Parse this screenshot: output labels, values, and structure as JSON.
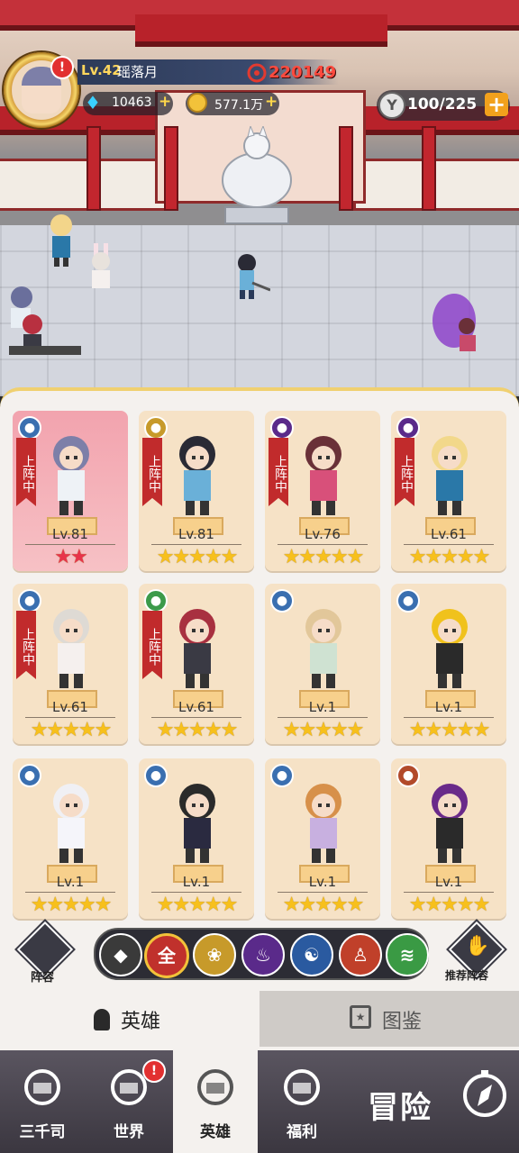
{
  "player": {
    "level": "Lv.42",
    "name": "瑶落月",
    "power": "220149",
    "diamonds": "10463",
    "gold": "577.1万",
    "energy": "100/225",
    "notice": "!"
  },
  "heroes": [
    {
      "level": "Lv.81",
      "stars": "★★",
      "star_color": "red",
      "deployed": true,
      "deploy_label": "上阵中",
      "element": "water",
      "element_color": "#3a6fb0",
      "bg": "pink"
    },
    {
      "level": "Lv.81",
      "stars": "★★★★★",
      "star_color": "gold",
      "deployed": true,
      "deploy_label": "上阵中",
      "element": "lotus",
      "element_color": "#c79a2a",
      "bg": "tan"
    },
    {
      "level": "Lv.76",
      "stars": "★★★★★",
      "star_color": "gold",
      "deployed": true,
      "deploy_label": "上阵中",
      "element": "fire",
      "element_color": "#5a2a8a",
      "bg": "tan"
    },
    {
      "level": "Lv.61",
      "stars": "★★★★★",
      "star_color": "gold",
      "deployed": true,
      "deploy_label": "上阵中",
      "element": "fire",
      "element_color": "#5a2a8a",
      "bg": "tan"
    },
    {
      "level": "Lv.61",
      "stars": "★★★★★",
      "star_color": "gold",
      "deployed": true,
      "deploy_label": "上阵中",
      "element": "water",
      "element_color": "#3a6fb0",
      "bg": "tan"
    },
    {
      "level": "Lv.61",
      "stars": "★★★★★",
      "star_color": "gold",
      "deployed": true,
      "deploy_label": "上阵中",
      "element": "dna",
      "element_color": "#3c9a4a",
      "bg": "tan"
    },
    {
      "level": "Lv.1",
      "stars": "★★★★★",
      "star_color": "gold",
      "deployed": false,
      "deploy_label": "",
      "element": "water",
      "element_color": "#3a6fb0",
      "bg": "tan"
    },
    {
      "level": "Lv.1",
      "stars": "★★★★★",
      "star_color": "gold",
      "deployed": false,
      "deploy_label": "",
      "element": "water",
      "element_color": "#3a6fb0",
      "bg": "tan"
    },
    {
      "level": "Lv.1",
      "stars": "★★★★★",
      "star_color": "gold",
      "deployed": false,
      "deploy_label": "",
      "element": "water",
      "element_color": "#3a6fb0",
      "bg": "tan"
    },
    {
      "level": "Lv.1",
      "stars": "★★★★★",
      "star_color": "gold",
      "deployed": false,
      "deploy_label": "",
      "element": "water",
      "element_color": "#3a6fb0",
      "bg": "tan"
    },
    {
      "level": "Lv.1",
      "stars": "★★★★★",
      "star_color": "gold",
      "deployed": false,
      "deploy_label": "",
      "element": "water",
      "element_color": "#3a6fb0",
      "bg": "tan"
    },
    {
      "level": "Lv.1",
      "stars": "★★★★★",
      "star_color": "gold",
      "deployed": false,
      "deploy_label": "",
      "element": "monk",
      "element_color": "#b24a2a",
      "bg": "tan"
    }
  ],
  "filter": {
    "lineup_label": "阵容",
    "all_label": "全",
    "recommend_label": "推荐阵容",
    "buttons": [
      {
        "name": "class-filter",
        "color": "#3a3a3a",
        "glyph": "◆"
      },
      {
        "name": "all-filter",
        "color": "#c0312c",
        "glyph": "全"
      },
      {
        "name": "lotus-filter",
        "color": "#c79a2a",
        "glyph": "❀"
      },
      {
        "name": "fire-filter",
        "color": "#5a2a8a",
        "glyph": "♨"
      },
      {
        "name": "water-filter",
        "color": "#2a5aa0",
        "glyph": "☯"
      },
      {
        "name": "monk-filter",
        "color": "#c0402a",
        "glyph": "♙"
      },
      {
        "name": "dna-filter",
        "color": "#3a9a44",
        "glyph": "≋"
      }
    ]
  },
  "tabs": {
    "heroes": "英雄",
    "codex": "图鉴"
  },
  "nav": {
    "items": [
      {
        "label": "三千司",
        "active": false
      },
      {
        "label": "世界",
        "active": false,
        "badge": "!"
      },
      {
        "label": "英雄",
        "active": true
      },
      {
        "label": "福利",
        "active": false
      }
    ],
    "adventure": "冒险"
  }
}
